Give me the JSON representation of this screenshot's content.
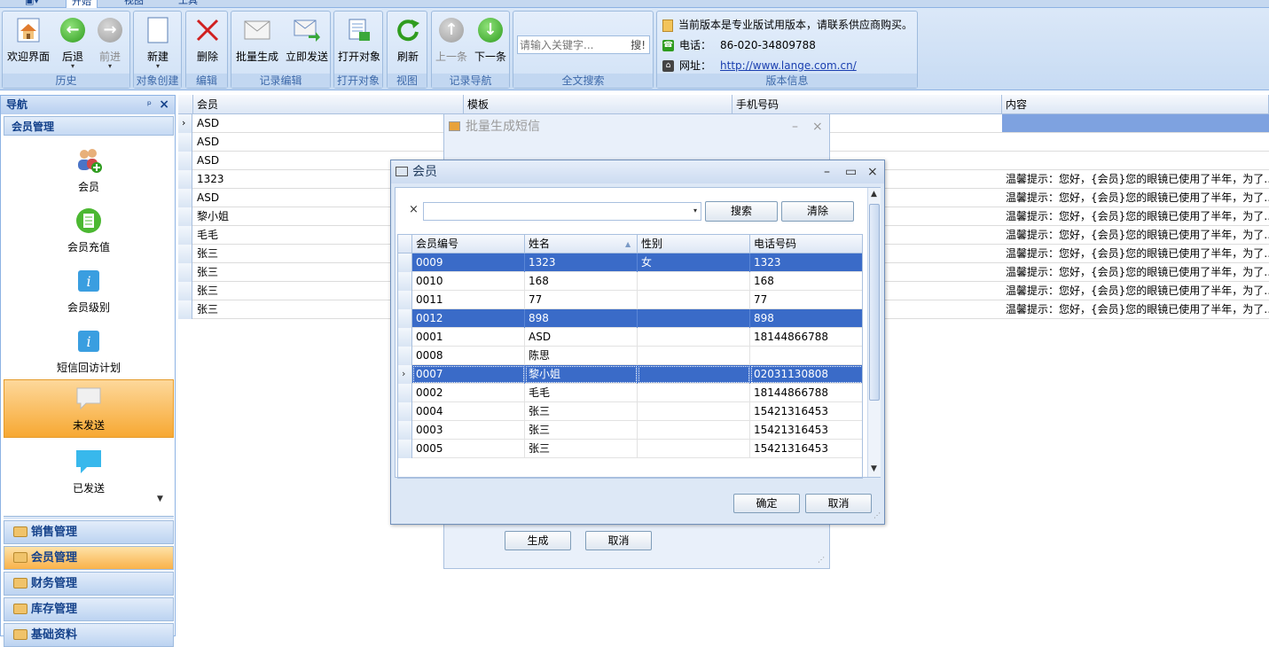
{
  "ribbon": {
    "tabs": [
      "开始",
      "视图",
      "工具"
    ],
    "groups": {
      "history": {
        "label": "历史",
        "welcome": "欢迎界面",
        "back": "后退",
        "forward": "前进"
      },
      "create": {
        "label": "对象创建",
        "new": "新建"
      },
      "edit": {
        "label": "编辑",
        "delete": "删除"
      },
      "record_edit": {
        "label": "记录编辑",
        "batch": "批量生成",
        "send": "立即发送"
      },
      "open": {
        "label": "打开对象",
        "open": "打开对象"
      },
      "view": {
        "label": "视图",
        "refresh": "刷新"
      },
      "nav": {
        "label": "记录导航",
        "prev": "上一条",
        "next": "下一条"
      },
      "search": {
        "label": "全文搜索",
        "placeholder": "请输入关键字...",
        "button": "搜!"
      },
      "version": {
        "label": "版本信息",
        "notice": "当前版本是专业版试用版本，请联系供应商购买。",
        "phone_label": "电话：",
        "phone": "86-020-34809788",
        "site_label": "网址：",
        "site": "http://www.lange.com.cn/"
      }
    }
  },
  "nav": {
    "title": "导航",
    "pin": "ᵖ",
    "close": "×",
    "section": "会员管理",
    "items": [
      "会员",
      "会员充值",
      "会员级别",
      "短信回访计划",
      "未发送",
      "已发送"
    ],
    "categories": [
      "销售管理",
      "会员管理",
      "财务管理",
      "库存管理",
      "基础资料"
    ]
  },
  "grid": {
    "columns": [
      "会员",
      "模板",
      "手机号码",
      "内容"
    ],
    "rows": [
      {
        "member": "ASD",
        "content": ""
      },
      {
        "member": "ASD",
        "content": ""
      },
      {
        "member": "ASD",
        "content": ""
      },
      {
        "member": "1323",
        "content": "温馨提示：您好，{会员}您的眼镜已使用了半年，为了…"
      },
      {
        "member": "ASD",
        "content": "温馨提示：您好，{会员}您的眼镜已使用了半年，为了…"
      },
      {
        "member": "黎小姐",
        "content": "温馨提示：您好，{会员}您的眼镜已使用了半年，为了…"
      },
      {
        "member": "毛毛",
        "content": "温馨提示：您好，{会员}您的眼镜已使用了半年，为了…"
      },
      {
        "member": "张三",
        "content": "温馨提示：您好，{会员}您的眼镜已使用了半年，为了…"
      },
      {
        "member": "张三",
        "content": "温馨提示：您好，{会员}您的眼镜已使用了半年，为了…"
      },
      {
        "member": "张三",
        "content": "温馨提示：您好，{会员}您的眼镜已使用了半年，为了…"
      },
      {
        "member": "张三",
        "content": "温馨提示：您好，{会员}您的眼镜已使用了半年，为了…"
      }
    ]
  },
  "batch_dialog": {
    "title": "批量生成短信",
    "generate": "生成",
    "cancel": "取消"
  },
  "member_dialog": {
    "title": "会员",
    "clear_x": "×",
    "search": "搜索",
    "clear": "清除",
    "ok": "确定",
    "cancel": "取消",
    "columns": [
      "会员编号",
      "姓名",
      "性别",
      "电话号码"
    ],
    "rows": [
      {
        "id": "0009",
        "name": "1323",
        "gender": "女",
        "phone": "1323"
      },
      {
        "id": "0010",
        "name": "168",
        "gender": "",
        "phone": "168"
      },
      {
        "id": "0011",
        "name": "77",
        "gender": "",
        "phone": "77"
      },
      {
        "id": "0012",
        "name": "898",
        "gender": "",
        "phone": "898"
      },
      {
        "id": "0001",
        "name": "ASD",
        "gender": "",
        "phone": "18144866788"
      },
      {
        "id": "0008",
        "name": "陈思",
        "gender": "",
        "phone": ""
      },
      {
        "id": "0007",
        "name": "黎小姐",
        "gender": "",
        "phone": "02031130808"
      },
      {
        "id": "0002",
        "name": "毛毛",
        "gender": "",
        "phone": "18144866788"
      },
      {
        "id": "0004",
        "name": "张三",
        "gender": "",
        "phone": "15421316453"
      },
      {
        "id": "0003",
        "name": "张三",
        "gender": "",
        "phone": "15421316453"
      },
      {
        "id": "0005",
        "name": "张三",
        "gender": "",
        "phone": "15421316453"
      }
    ]
  }
}
